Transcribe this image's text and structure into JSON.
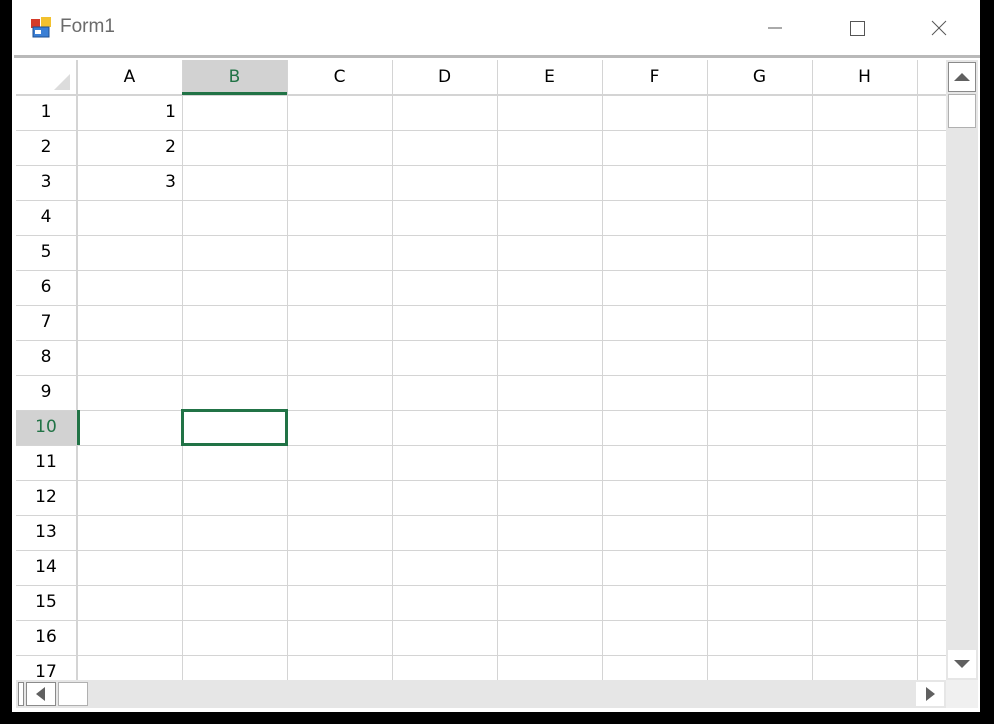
{
  "window": {
    "title": "Form1"
  },
  "icons": {
    "app": "form-app-icon",
    "minimize": "minimize-icon",
    "maximize": "maximize-icon",
    "close": "close-icon",
    "scroll_up": "scroll-up-arrow-icon",
    "scroll_down": "scroll-down-arrow-icon",
    "scroll_left": "scroll-left-arrow-icon",
    "scroll_right": "scroll-right-arrow-icon"
  },
  "spreadsheet": {
    "columns": [
      "A",
      "B",
      "C",
      "D",
      "E",
      "F",
      "G",
      "H"
    ],
    "rows": [
      "1",
      "2",
      "3",
      "4",
      "5",
      "6",
      "7",
      "8",
      "9",
      "10",
      "11",
      "12",
      "13",
      "14",
      "15",
      "16",
      "17"
    ],
    "cells": [
      {
        "ref": "A1",
        "col": 0,
        "row": 0,
        "value": "1"
      },
      {
        "ref": "A2",
        "col": 0,
        "row": 1,
        "value": "2"
      },
      {
        "ref": "A3",
        "col": 0,
        "row": 2,
        "value": "3"
      }
    ],
    "selected": {
      "ref": "B10",
      "col": 1,
      "row": 9
    }
  },
  "colors": {
    "accent": "#217346",
    "grid_line": "#d4d4d4",
    "header_bg": "#ffffff",
    "selected_header_bg": "#d2d2d2",
    "header_text": "#000000",
    "selected_header_text": "#217346",
    "title_text": "#6b6b6b"
  }
}
